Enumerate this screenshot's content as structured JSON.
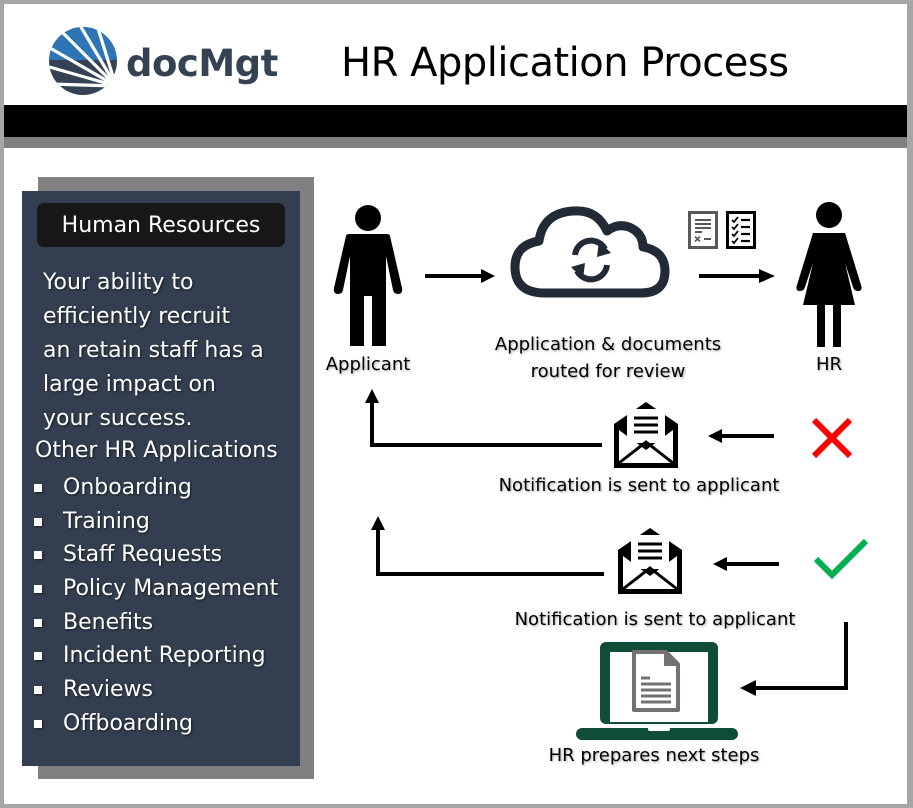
{
  "header": {
    "logo_text": "docMgt",
    "title": "HR Application Process"
  },
  "sidebar": {
    "badge": "Human Resources",
    "intro_lines": [
      "Your ability to",
      "efficiently recruit",
      "an retain staff has a",
      "large impact on",
      "your success."
    ],
    "other_heading": "Other HR Applications",
    "items": [
      {
        "label": "Onboarding"
      },
      {
        "label": "Training"
      },
      {
        "label": "Staff Requests"
      },
      {
        "label": "Policy Management"
      },
      {
        "label": "Benefits"
      },
      {
        "label": "Incident Reporting"
      },
      {
        "label": "Reviews"
      },
      {
        "label": "Offboarding"
      }
    ]
  },
  "flow": {
    "applicant_label": "Applicant",
    "routing_label_line1": "Application & documents",
    "routing_label_line2": "routed for review",
    "hr_label": "HR",
    "rejected_notification": "Notification is sent to applicant",
    "approved_notification": "Notification is sent to applicant",
    "next_steps_label": "HR prepares next steps"
  },
  "colors": {
    "panel_bg": "#333f50",
    "panel_shadow": "#808080",
    "badge_bg": "#171717",
    "logo_dark": "#344254",
    "logo_blue": "#2e75b6",
    "reject_red": "#ff0000",
    "approve_green": "#00b050",
    "laptop_green": "#0f4c3a",
    "document_gray": "#767171"
  }
}
